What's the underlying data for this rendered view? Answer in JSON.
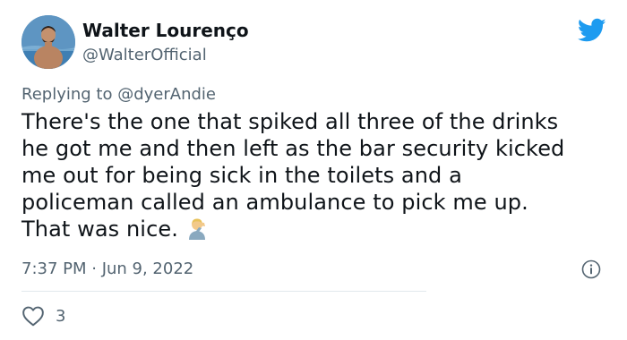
{
  "user": {
    "display_name": "Walter Lourenço",
    "handle": "@WalterOfficial",
    "avatar_icon": "avatar-photo"
  },
  "brand": {
    "logo_icon": "twitter-bird-icon",
    "color": "#1d9bf0"
  },
  "reply": {
    "prefix": "Replying to ",
    "handle": "@dyerAndie"
  },
  "tweet": {
    "lines": [
      "There's the one that spiked all three of the drinks",
      "he got me and then left as the bar security kicked",
      "me out for being sick in the toilets and a",
      "policeman called an ambulance to pick me up.",
      "That was nice."
    ],
    "emoji_icon": "person-facepalming-emoji",
    "timestamp": "7:37 PM · Jun 9, 2022"
  },
  "actions": {
    "info_icon": "info-icon",
    "like_icon": "heart-icon",
    "like_count": "3"
  },
  "colors": {
    "text_primary": "#0f1419",
    "text_secondary": "#536471",
    "divider": "#e1e8ed"
  }
}
